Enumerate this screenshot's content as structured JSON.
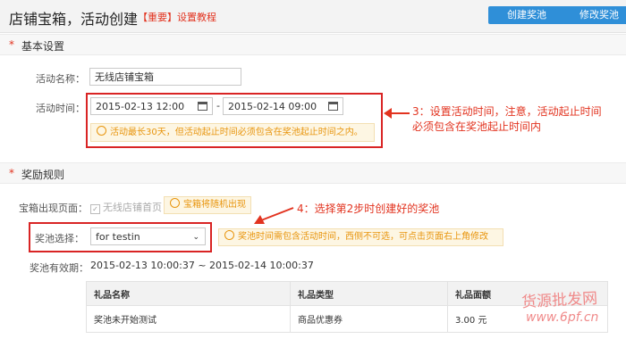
{
  "header": {
    "title": "店铺宝箱，活动创建",
    "tag": "【重要】设置教程",
    "create_button": "创建奖池",
    "edit_button": "修改奖池"
  },
  "basic_section": {
    "title": "基本设置",
    "name_label": "活动名称：",
    "name_value": "无线店铺宝箱",
    "time_label": "活动时间：",
    "start_time": "2015-02-13 12:00",
    "separator": "-",
    "end_time": "2015-02-14 09:00",
    "time_hint": "活动最长30天，但活动起止时间必须包含在奖池起止时间之内。"
  },
  "annotation_3": {
    "line1": "3：设置活动时间，注意，活动起止时间",
    "line2": "必须包含在奖池起止时间内"
  },
  "reward_section": {
    "title": "奖励规则",
    "page_label": "宝箱出现页面：",
    "page_option": "无线店铺首页",
    "page_hint": "宝箱将随机出现",
    "pool_label": "奖池选择：",
    "pool_value": "for testin",
    "pool_hint": "奖池时间需包含活动时间，西侧不可选，可点击页面右上角修改",
    "validity_label": "奖池有效期：",
    "validity_value": "2015-02-13 10:00:37 ~ 2015-02-14 10:00:37"
  },
  "annotation_4": {
    "text": "4：选择第2步时创建好的奖池"
  },
  "prize_table": {
    "headers": [
      "礼品名称",
      "礼品类型",
      "礼品面额"
    ],
    "rows": [
      [
        "奖池未开始测试",
        "商品优惠券",
        "3.00 元"
      ]
    ]
  },
  "watermark": {
    "text": "货源批发网",
    "url": "www.6pf.cn"
  },
  "colors": {
    "accent_blue": "#2f8fd8",
    "annotation_red": "#e2331f",
    "hint_orange": "#e8950e"
  }
}
